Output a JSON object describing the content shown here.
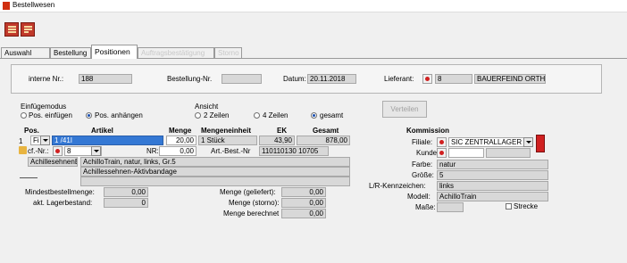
{
  "window": {
    "title": "Bestellwesen"
  },
  "toolbar": {
    "buttons": [
      "toolbar-button-1-icon",
      "toolbar-button-2-icon"
    ]
  },
  "tabs": [
    {
      "label": "Auswahl",
      "state": "normal"
    },
    {
      "label": "Bestellung",
      "state": "normal"
    },
    {
      "label": "Positionen",
      "state": "active"
    },
    {
      "label": "Auftragsbestätigung",
      "state": "disabled"
    },
    {
      "label": "Storno",
      "state": "disabled"
    }
  ],
  "header": {
    "interne_nr_label": "interne Nr.:",
    "interne_nr_value": "188",
    "bestellung_nr_label": "Bestellung-Nr.",
    "bestellung_nr_value": "",
    "datum_label": "Datum:",
    "datum_value": "20.11.2018",
    "lieferant_label": "Lieferant:",
    "lieferant_nr": "8",
    "lieferant_name": "BAUERFEIND ORTH"
  },
  "einfuegemodus": {
    "title": "Einfügemodus",
    "option1": "Pos. einfügen",
    "option2": "Pos. anhängen",
    "selected": "option2"
  },
  "ansicht": {
    "title": "Ansicht",
    "option1": "2 Zeilen",
    "option2": "4 Zeilen",
    "option3": "gesamt",
    "selected": "option3"
  },
  "verteilen_button": "Verteilen",
  "columns": {
    "pos": "Pos.",
    "artikel": "Artikel",
    "menge": "Menge",
    "mengeneinheit": "Mengeneinheit",
    "ek": "EK",
    "gesamt": "Gesamt",
    "kommission": "Kommission"
  },
  "row": {
    "pos": "1",
    "typ": "Fi",
    "artikel_nr": "1   /41I",
    "menge": "20,00",
    "mengeneinheit": "1 Stück",
    "ek": "43,90",
    "gesamt": "878,00",
    "ref_label": "cf.-Nr.:",
    "ref_value": "8",
    "nr_label": "NR:",
    "nr_value": "0,00",
    "art_best_nr_label": "Art.-Best.-Nr",
    "art_best_nr_value": "110110130 10705",
    "short_name": "AchillesehnenB",
    "desc1": "AchilloTrain, natur, links, Gr.5",
    "desc2": "Achillessehnen-Aktivbandage"
  },
  "details": {
    "mindestbestellmenge_label": "Mindestbestellmenge:",
    "mindestbestellmenge_value": "0,00",
    "lagerbestand_label": "akt. Lagerbestand:",
    "lagerbestand_value": "0",
    "menge_geliefert_label": "Menge (geliefert):",
    "menge_geliefert_value": "0,00",
    "menge_storno_label": "Menge (storno):",
    "menge_storno_value": "0,00",
    "menge_berechnet_label": "Menge berechnet",
    "menge_berechnet_value": "0,00"
  },
  "kommission": {
    "filiale_label": "Filiale:",
    "filiale_value": "SIC ZENTRALLAGER",
    "kunde_label": "Kunde",
    "kunde_value": "",
    "farbe_label": "Farbe:",
    "farbe_value": "natur",
    "groesse_label": "Größe:",
    "groesse_value": "5",
    "lr_label": "L/R-Kennzeichen:",
    "lr_value": "links",
    "modell_label": "Modell:",
    "modell_value": "AchilloTrain",
    "masse_label": "Maße:",
    "masse_value": "",
    "strecke_label": "Strecke",
    "strecke_checked": false
  },
  "colors": {
    "accent_red": "#c0392b",
    "field_gray": "#d8d8d8",
    "radio_blue": "#1a4fb0"
  }
}
